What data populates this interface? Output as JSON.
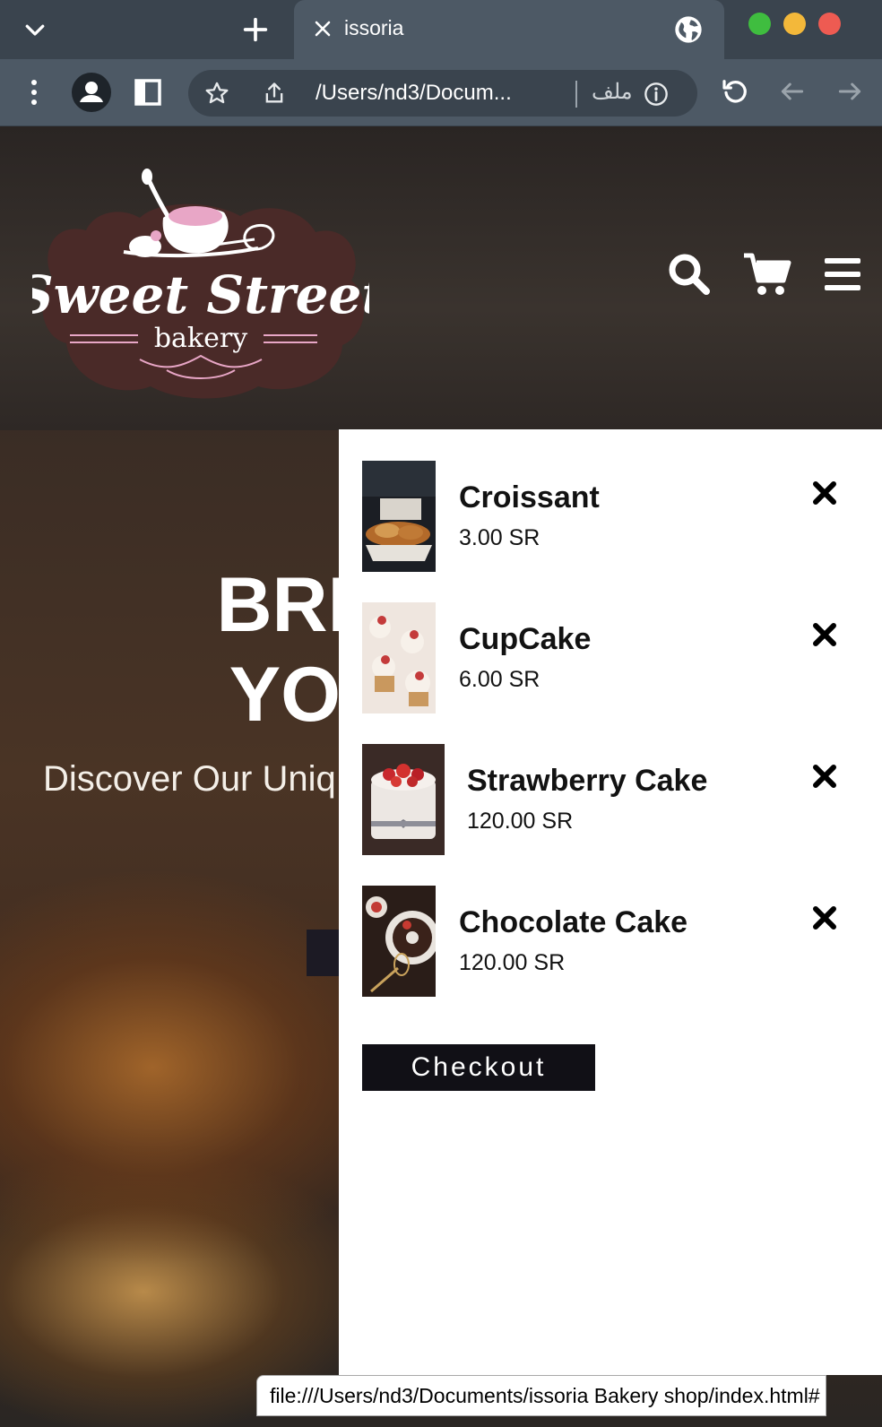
{
  "browser": {
    "tab_title": "issoria",
    "url": "/Users/nd3/Docum...",
    "site_info_label": "ملف",
    "status_url": "file:///Users/nd3/Documents/issoria Bakery shop/index.html#"
  },
  "site": {
    "logo": {
      "line1": "Sweet Street",
      "line2": "bakery"
    },
    "hero": {
      "headline_line1": "BRING",
      "headline_line2": "YOUR",
      "subtitle": "Discover Our Uniq"
    }
  },
  "cart": {
    "items": [
      {
        "name": "Croissant",
        "price": "3.00 SR"
      },
      {
        "name": "CupCake",
        "price": "6.00 SR"
      },
      {
        "name": "Strawberry Cake",
        "price": "120.00 SR"
      },
      {
        "name": "Chocolate Cake",
        "price": "120.00 SR"
      }
    ],
    "checkout_label": "Checkout"
  },
  "colors": {
    "chrome_dark": "#3a444e",
    "chrome_light": "#4d5965",
    "logo_brown": "#4a2a28",
    "logo_pink": "#e8a6c6",
    "checkout_bg": "#111016",
    "close_red": "#ee5b52",
    "minimize_yellow": "#f3b83a",
    "zoom_green": "#3fbd3f"
  }
}
